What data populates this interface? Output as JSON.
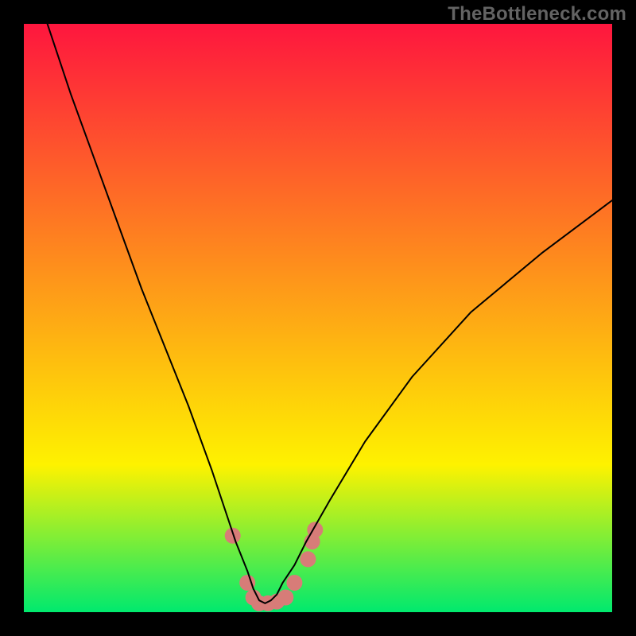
{
  "watermark": "TheBottleneck.com",
  "chart_data": {
    "type": "line",
    "title": "",
    "xlabel": "",
    "ylabel": "",
    "xlim": [
      0,
      100
    ],
    "ylim": [
      0,
      100
    ],
    "grid": false,
    "legend": false,
    "background_gradient": {
      "top_color": "#fe163e",
      "mid_color": "#fef200",
      "bottom_color": "#00e96e",
      "stops": [
        0,
        75,
        100
      ]
    },
    "series": [
      {
        "name": "curve",
        "color": "#000000",
        "stroke_width": 2,
        "x": [
          4,
          8,
          12,
          16,
          20,
          24,
          28,
          32,
          34,
          36,
          38,
          39,
          40,
          41,
          42,
          43,
          44,
          46,
          48,
          52,
          58,
          66,
          76,
          88,
          100
        ],
        "y": [
          100,
          88,
          77,
          66,
          55,
          45,
          35,
          24,
          18,
          12,
          7,
          4,
          2,
          1.5,
          2,
          3,
          5,
          8,
          12,
          19,
          29,
          40,
          51,
          61,
          70
        ]
      }
    ],
    "markers": {
      "name": "bottom-cluster",
      "color": "#d77c78",
      "radius": 10,
      "points": [
        {
          "x": 35.5,
          "y": 13
        },
        {
          "x": 38,
          "y": 5
        },
        {
          "x": 39,
          "y": 2.5
        },
        {
          "x": 40,
          "y": 1.5
        },
        {
          "x": 41.5,
          "y": 1.5
        },
        {
          "x": 43,
          "y": 1.8
        },
        {
          "x": 44.5,
          "y": 2.5
        },
        {
          "x": 46,
          "y": 5
        },
        {
          "x": 48.3,
          "y": 9
        },
        {
          "x": 49,
          "y": 12
        },
        {
          "x": 49.5,
          "y": 14
        }
      ]
    }
  }
}
